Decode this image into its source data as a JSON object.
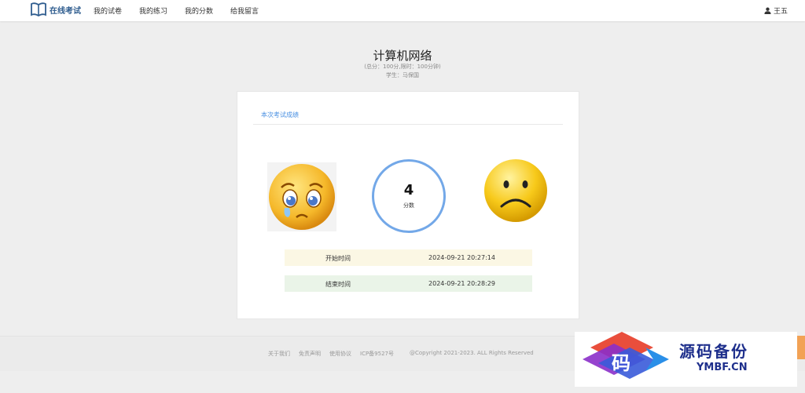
{
  "header": {
    "logo_text": "在线考试",
    "nav": [
      "我的试卷",
      "我的练习",
      "我的分数",
      "给我留言"
    ],
    "user_name": "王五"
  },
  "exam": {
    "title": "计算机网络",
    "info": "(总分：100分,限时：100分钟)",
    "student": "学生：马保国"
  },
  "result": {
    "card_title": "本次考试成绩",
    "score": "4",
    "score_label": "分数",
    "start_label": "开始时间",
    "start_time": "2024-09-21 20:27:14",
    "end_label": "结束时间",
    "end_time": "2024-09-21 20:28:29"
  },
  "footer": {
    "links": [
      "关于我们",
      "免责声明",
      "使用协议",
      "ICP备9527号"
    ],
    "copyright": "@Copyright 2021-2023. ALL Rights Reserved"
  },
  "watermark": {
    "char": "码",
    "title": "源码备份",
    "sub": "YMBF.CN"
  },
  "colors": {
    "accent": "#4a90e2",
    "ring": "#73a8e8",
    "start_row": "#fbf7e4",
    "end_row": "#eaf4e8",
    "logo": "#2f5d8f"
  },
  "icons": [
    "book-icon",
    "user-icon",
    "crying-face-icon",
    "sad-face-icon"
  ]
}
